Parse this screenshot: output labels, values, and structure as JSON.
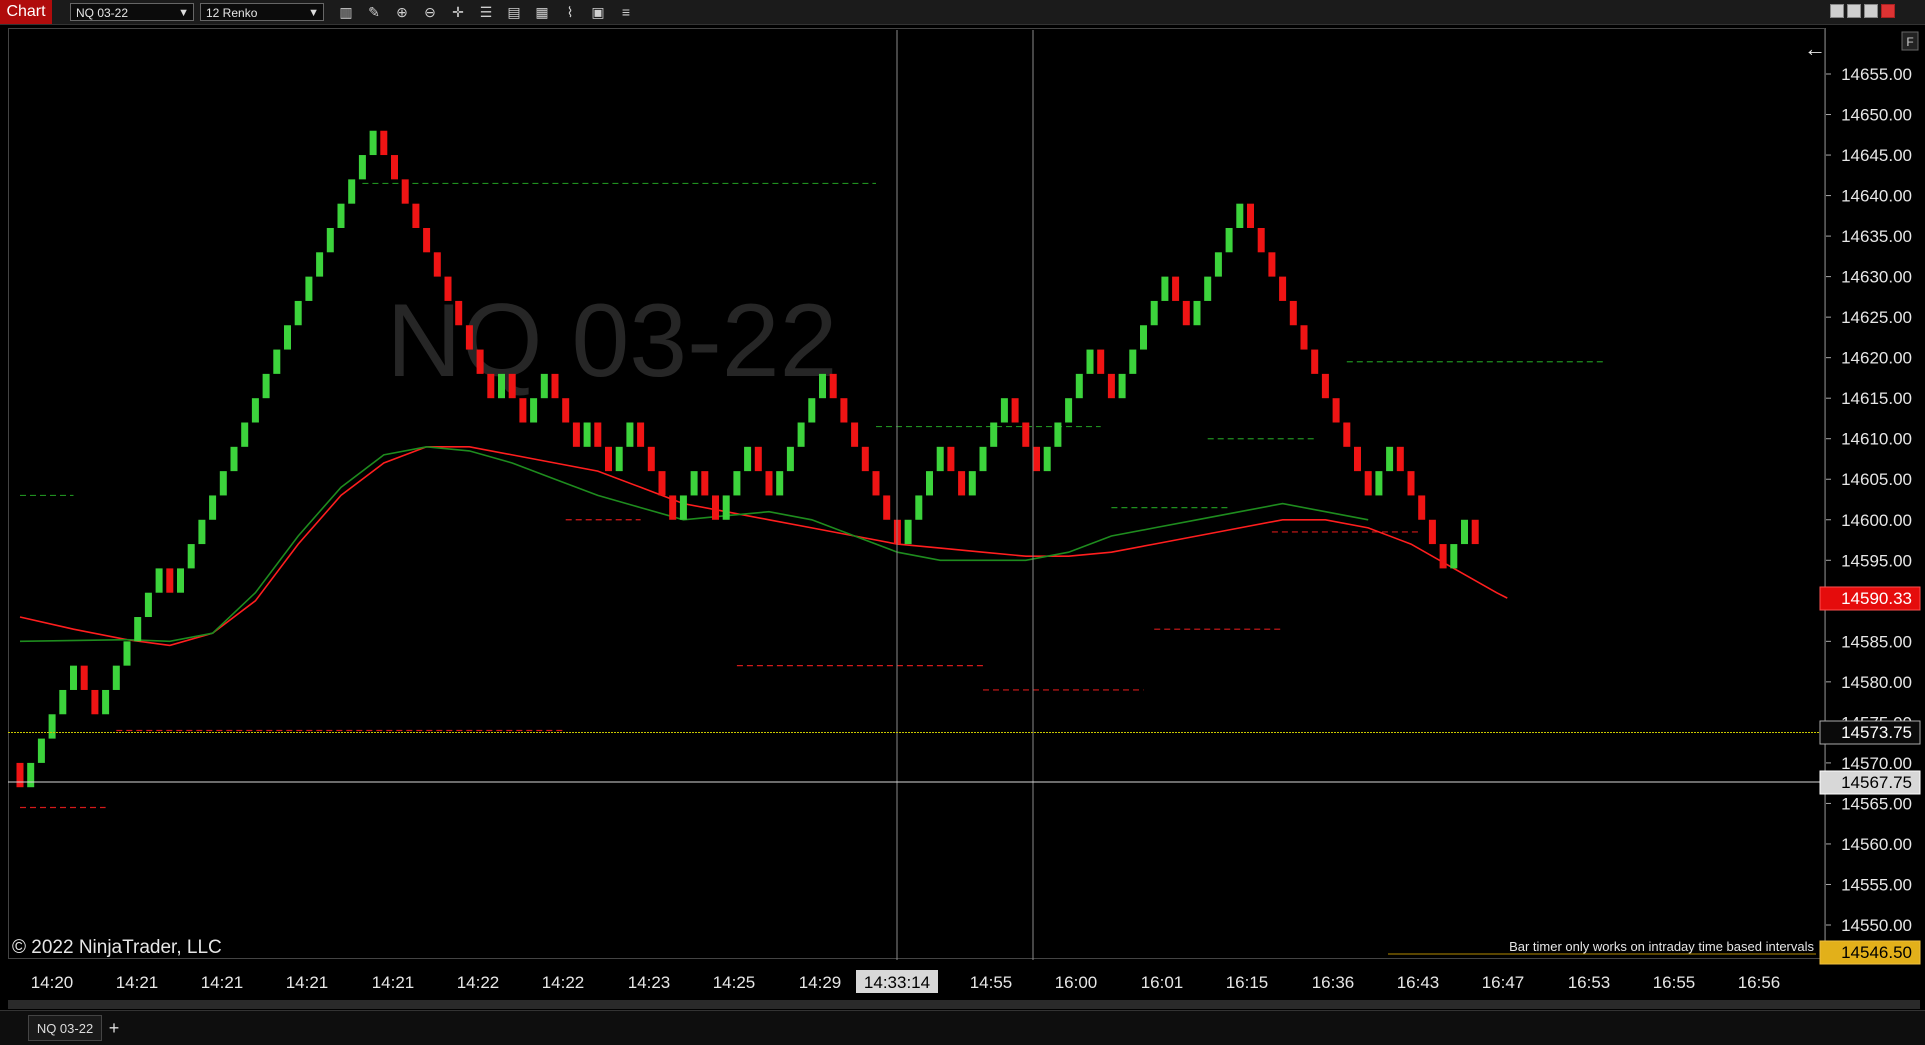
{
  "toolbar": {
    "chart_tab": "Chart",
    "instrument": "NQ 03-22",
    "bar_type": "12 Renko",
    "tools": [
      "bar-type-icon",
      "draw-pen-icon",
      "zoom-in-icon",
      "zoom-out-icon",
      "crosshair-icon",
      "properties-icon",
      "templates-icon",
      "data-box-icon",
      "strategies-icon",
      "indicator-icon",
      "list-icon"
    ]
  },
  "chart": {
    "watermark": "NQ 03-22",
    "copyright": "© 2022 NinjaTrader, LLC",
    "bar_timer_msg": "Bar timer only works on intraday time based intervals",
    "float_label": "F",
    "crosshair_time": "14:33:14",
    "price_labels": {
      "sma": "14590.33",
      "last": "14573.75",
      "crosshair": "14567.75",
      "bottom": "14546.50"
    },
    "colors": {
      "up": "#3cd33c",
      "down": "#f01414",
      "sma": "#ff1e1e",
      "ema": "#1e8c1e",
      "last_line": "#c8c800"
    }
  },
  "chart_data": {
    "type": "candlestick",
    "bar_type": "12 Renko (3 points)",
    "y_ticks": [
      "14655.00",
      "14650.00",
      "14645.00",
      "14640.00",
      "14635.00",
      "14630.00",
      "14625.00",
      "14620.00",
      "14615.00",
      "14610.00",
      "14605.00",
      "14600.00",
      "14595.00",
      "14590.00",
      "14585.00",
      "14580.00",
      "14575.00",
      "14570.00",
      "14565.00",
      "14560.00",
      "14555.00",
      "14550.00"
    ],
    "x_ticks": [
      "14:20",
      "14:21",
      "14:21",
      "14:21",
      "14:21",
      "14:22",
      "14:22",
      "14:23",
      "14:25",
      "14:29",
      "14:33:14",
      "14:55",
      "16:00",
      "16:01",
      "16:15",
      "16:36",
      "16:43",
      "16:47",
      "16:53",
      "16:55",
      "16:56"
    ],
    "bricks": [
      -1,
      1,
      1,
      1,
      1,
      1,
      -1,
      -1,
      1,
      1,
      1,
      1,
      1,
      1,
      -1,
      1,
      1,
      1,
      1,
      1,
      1,
      1,
      1,
      1,
      1,
      1,
      1,
      1,
      1,
      1,
      1,
      1,
      1,
      1,
      -1,
      -1,
      -1,
      -1,
      -1,
      -1,
      -1,
      -1,
      -1,
      -1,
      -1,
      1,
      -1,
      -1,
      1,
      1,
      -1,
      -1,
      -1,
      1,
      -1,
      -1,
      1,
      1,
      -1,
      -1,
      -1,
      -1,
      1,
      1,
      -1,
      -1,
      1,
      1,
      1,
      -1,
      -1,
      1,
      1,
      1,
      1,
      1,
      -1,
      -1,
      -1,
      -1,
      -1,
      -1,
      -1,
      1,
      1,
      1,
      1,
      -1,
      -1,
      1,
      1,
      1,
      1,
      -1,
      -1,
      -1,
      1,
      1,
      1,
      1,
      1,
      -1,
      -1,
      1,
      1,
      1,
      1,
      1,
      -1,
      -1,
      1,
      1,
      1,
      1,
      1,
      -1,
      -1,
      -1,
      -1,
      -1,
      -1,
      -1,
      -1,
      -1,
      -1,
      -1,
      -1,
      1,
      1,
      -1,
      -1,
      -1,
      -1,
      -1,
      1,
      1,
      -1
    ],
    "first_brick_open": 14567,
    "brick_size": 3,
    "sma": [
      [
        14588,
        0
      ],
      [
        14586.5,
        5
      ],
      [
        14585.2,
        10
      ],
      [
        14584.5,
        14
      ],
      [
        14586,
        18
      ],
      [
        14590,
        22
      ],
      [
        14597,
        26
      ],
      [
        14603,
        30
      ],
      [
        14607,
        34
      ],
      [
        14609,
        38
      ],
      [
        14609,
        42
      ],
      [
        14608,
        46
      ],
      [
        14607,
        50
      ],
      [
        14606,
        54
      ],
      [
        14604,
        58
      ],
      [
        14602,
        62
      ],
      [
        14601,
        66
      ],
      [
        14600,
        70
      ],
      [
        14599,
        74
      ],
      [
        14598,
        78
      ],
      [
        14597,
        82
      ],
      [
        14596.5,
        86
      ],
      [
        14596,
        90
      ],
      [
        14595.5,
        94
      ],
      [
        14595.5,
        98
      ],
      [
        14596,
        102
      ],
      [
        14597,
        106
      ],
      [
        14598,
        110
      ],
      [
        14599,
        114
      ],
      [
        14600,
        118
      ],
      [
        14600,
        122
      ],
      [
        14599,
        126
      ],
      [
        14597,
        130
      ],
      [
        14594,
        134
      ],
      [
        14591,
        138
      ],
      [
        14590.33,
        139
      ]
    ],
    "ema": [
      [
        14585,
        0
      ],
      [
        14585.2,
        10
      ],
      [
        14585,
        14
      ],
      [
        14586,
        18
      ],
      [
        14591,
        22
      ],
      [
        14598,
        26
      ],
      [
        14604,
        30
      ],
      [
        14608,
        34
      ],
      [
        14609,
        38
      ],
      [
        14608.5,
        42
      ],
      [
        14607,
        46
      ],
      [
        14605,
        50
      ],
      [
        14603,
        54
      ],
      [
        14601.5,
        58
      ],
      [
        14600,
        62
      ],
      [
        14600.5,
        66
      ],
      [
        14601,
        70
      ],
      [
        14600,
        74
      ],
      [
        14598,
        78
      ],
      [
        14596,
        82
      ],
      [
        14595,
        86
      ],
      [
        14595,
        90
      ],
      [
        14595,
        94
      ],
      [
        14596,
        98
      ],
      [
        14598,
        102
      ],
      [
        14599,
        106
      ],
      [
        14600,
        110
      ],
      [
        14601,
        114
      ],
      [
        14602,
        118
      ],
      [
        14601,
        122
      ],
      [
        14600,
        126
      ]
    ],
    "levels": [
      {
        "price": 14641.5,
        "from": 32,
        "to": 80,
        "color": "green"
      },
      {
        "price": 14619.5,
        "from": 124,
        "to": 148,
        "color": "green"
      },
      {
        "price": 14611.5,
        "from": 80,
        "to": 101,
        "color": "green"
      },
      {
        "price": 14610,
        "from": 111,
        "to": 121,
        "color": "green"
      },
      {
        "price": 14603,
        "from": 0,
        "to": 5,
        "color": "green"
      },
      {
        "price": 14601.5,
        "from": 102,
        "to": 113,
        "color": "green"
      },
      {
        "price": 14600,
        "from": 51,
        "to": 58,
        "color": "red"
      },
      {
        "price": 14598.5,
        "from": 117,
        "to": 131,
        "color": "red"
      },
      {
        "price": 14586.5,
        "from": 106,
        "to": 118,
        "color": "red"
      },
      {
        "price": 14582,
        "from": 67,
        "to": 90,
        "color": "red"
      },
      {
        "price": 14579,
        "from": 90,
        "to": 105,
        "color": "red"
      },
      {
        "price": 14574,
        "from": 9,
        "to": 51,
        "color": "red"
      },
      {
        "price": 14564.5,
        "from": 0,
        "to": 8,
        "color": "red"
      }
    ],
    "y_range": [
      14546.5,
      14658.5
    ]
  }
}
